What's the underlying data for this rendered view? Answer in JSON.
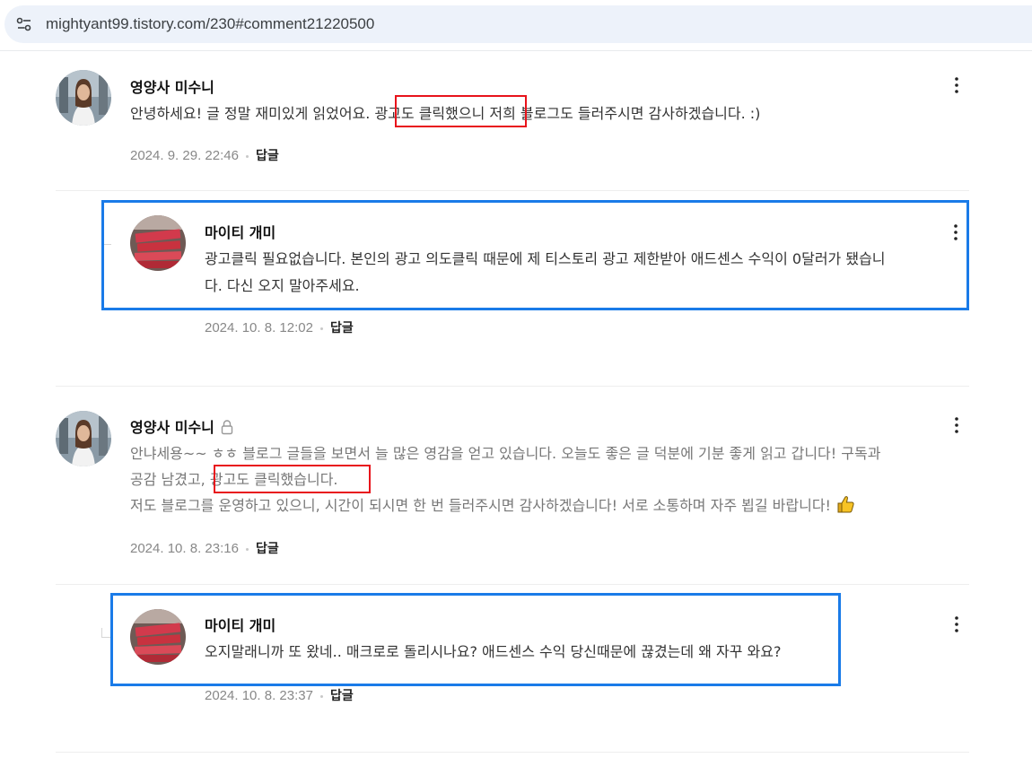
{
  "browser": {
    "url": "mightyant99.tistory.com/230#comment21220500",
    "site_info_icon": "tune-icon"
  },
  "colors": {
    "highlight_red": "#e8131b",
    "highlight_blue": "#1a7be8"
  },
  "comments": [
    {
      "author": "영양사 미수니",
      "lines": [
        "안녕하세요! 글 정말 재미있게 읽었어요. 광고도 클릭했으니 저희 블로그도 들러주시면 감사하겠습니다. :)"
      ],
      "date": "2024. 9. 29. 22:46",
      "reply_label": "답글",
      "reply": {
        "author": "마이티 개미",
        "lines": [
          "광고클릭 필요없습니다. 본인의 광고 의도클릭 때문에 제 티스토리 광고 제한받아 애드센스 수익이 0달러가 됐습니",
          "다. 다신 오지 말아주세요."
        ],
        "date": "2024. 10. 8. 12:02",
        "reply_label": "답글"
      }
    },
    {
      "author": "영양사 미수니",
      "secret": true,
      "lines": [
        "안냐세용~~ ㅎㅎ 블로그 글들을 보면서 늘 많은 영감을 얻고 있습니다. 오늘도 좋은 글 덕분에 기분 좋게 읽고 갑니다! 구독과",
        "공감 남겼고, 광고도 클릭했습니다.",
        "저도 블로그를 운영하고 있으니, 시간이 되시면 한 번 들러주시면 감사하겠습니다! 서로 소통하며 자주 뵙길 바랍니다!"
      ],
      "emoji": "thumbs-up-emoji",
      "date": "2024. 10. 8. 23:16",
      "reply_label": "답글",
      "reply": {
        "author": "마이티 개미",
        "lines": [
          "오지말래니까 또 왔네.. 매크로로 돌리시나요? 애드센스 수익 당신때문에 끊겼는데 왜 자꾸 와요?"
        ],
        "date": "2024. 10. 8. 23:37",
        "reply_label": "답글"
      }
    }
  ]
}
